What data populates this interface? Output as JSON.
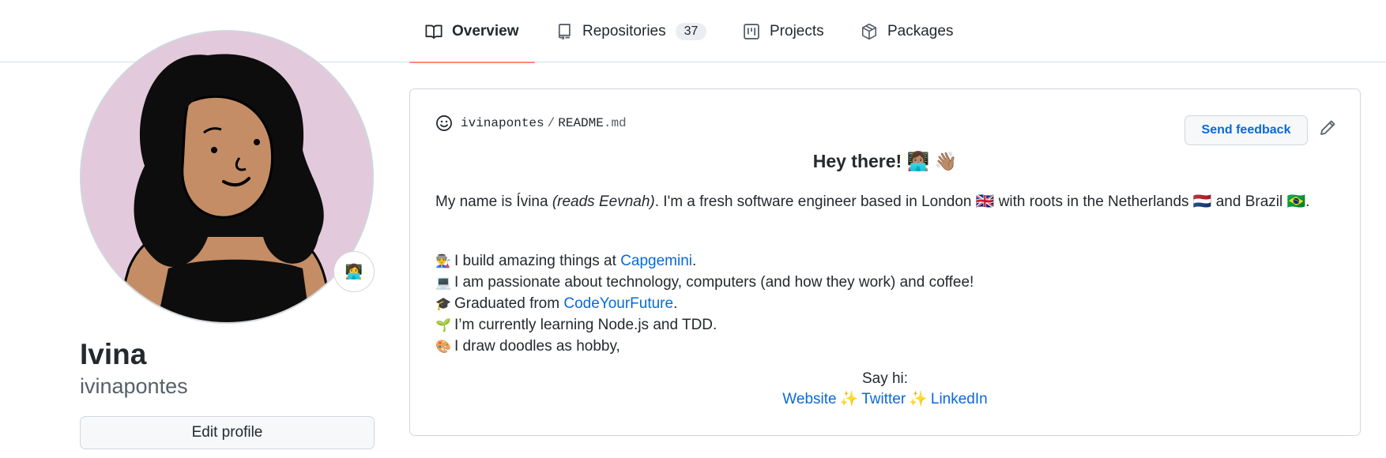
{
  "nav": {
    "tabs": [
      {
        "label": "Overview",
        "icon": "book-icon",
        "active": true
      },
      {
        "label": "Repositories",
        "icon": "repo-icon",
        "count": "37"
      },
      {
        "label": "Projects",
        "icon": "project-icon"
      },
      {
        "label": "Packages",
        "icon": "package-icon"
      }
    ]
  },
  "profile": {
    "name": "Ivina",
    "username": "ivinapontes",
    "edit_label": "Edit profile",
    "status_emoji": "👩‍💻"
  },
  "readme": {
    "owner": "ivinapontes",
    "slash": "/",
    "file_base": "README",
    "file_ext": ".md",
    "feedback_label": "Send feedback",
    "heading": "Hey there! 👩🏽‍💻 👋🏽",
    "intro_pre": "My name is Ívina ",
    "intro_em": "(reads Eevnah)",
    "intro_post": ". I'm a fresh software engineer based in London 🇬🇧 with roots in the Netherlands 🇳🇱 and Brazil 🇧🇷.",
    "lines": [
      {
        "emoji": "👨‍🏭",
        "pre": "I build amazing things at ",
        "link": "Capgemini",
        "post": "."
      },
      {
        "emoji": "💻",
        "pre": "I am passionate about technology, computers (and how they work) and coffee!",
        "link": "",
        "post": ""
      },
      {
        "emoji": "🎓",
        "pre": "Graduated from ",
        "link": "CodeYourFuture",
        "post": "."
      },
      {
        "emoji": "🌱",
        "pre": "I’m currently learning Node.js and TDD.",
        "link": "",
        "post": ""
      },
      {
        "emoji": "🎨",
        "pre": "I draw doodles as hobby,",
        "link": "",
        "post": ""
      }
    ],
    "say_hi": "Say hi:",
    "links": [
      "Website",
      "Twitter",
      "LinkedIn"
    ],
    "sparkle": "✨"
  },
  "colors": {
    "accent": "#0969da",
    "tab_underline": "#fd8c73",
    "avatar_bg": "#e3c9dc"
  }
}
